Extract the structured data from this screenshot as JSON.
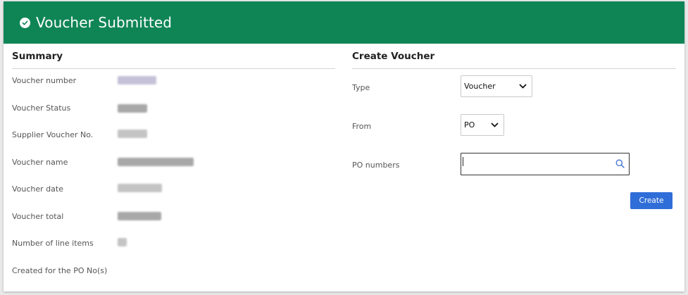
{
  "banner": {
    "title": "Voucher Submitted",
    "icon": "check-circle-icon",
    "color": "#0f8556"
  },
  "summary": {
    "title": "Summary",
    "fields": [
      {
        "label": "Voucher number"
      },
      {
        "label": "Voucher Status"
      },
      {
        "label": "Supplier Voucher No."
      },
      {
        "label": "Voucher name"
      },
      {
        "label": "Voucher date"
      },
      {
        "label": "Voucher total"
      },
      {
        "label": "Number of line items"
      },
      {
        "label": "Created for the PO No(s)"
      }
    ]
  },
  "create": {
    "title": "Create Voucher",
    "type": {
      "label": "Type",
      "value": "Voucher"
    },
    "from": {
      "label": "From",
      "value": "PO"
    },
    "po_numbers": {
      "label": "PO numbers",
      "value": ""
    },
    "button_label": "Create",
    "button_color": "#2f6ed8"
  }
}
